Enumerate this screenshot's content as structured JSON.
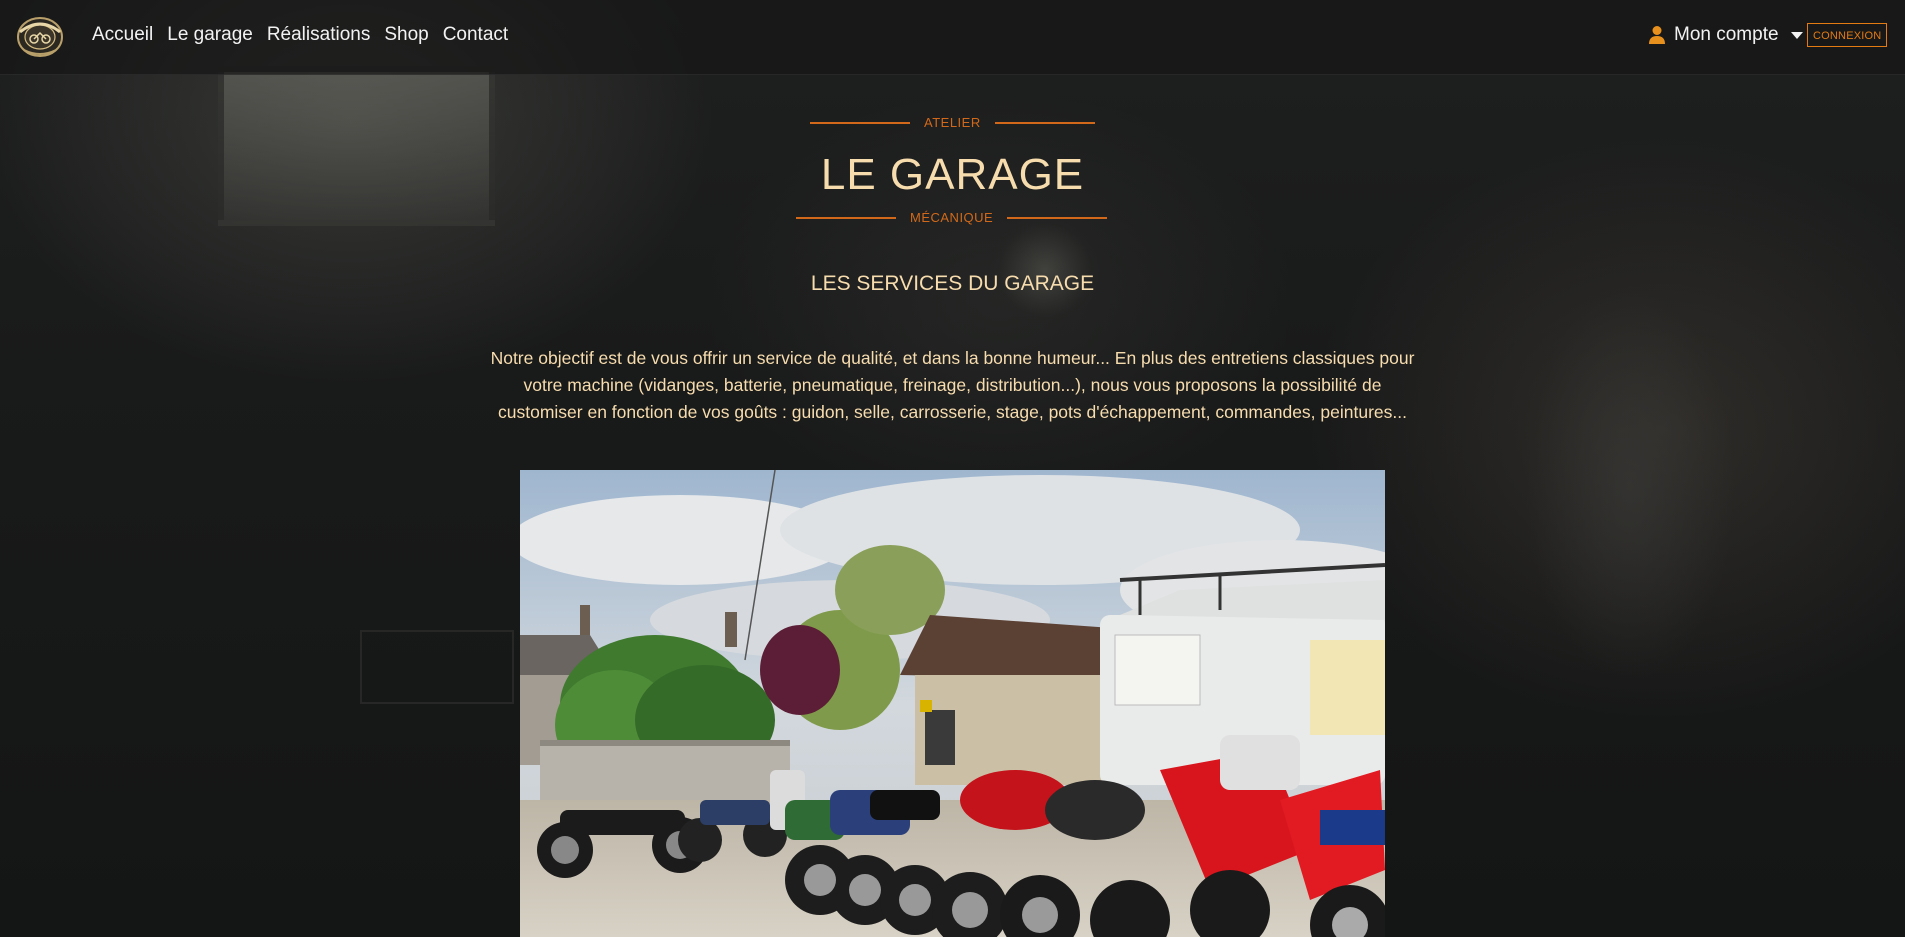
{
  "nav": {
    "links": [
      "Accueil",
      "Le garage",
      "Réalisations",
      "Shop",
      "Contact"
    ],
    "account_label": "Mon compte",
    "connexion_label": "CONNEXION"
  },
  "hero": {
    "eyebrow_top": "ATELIER",
    "title": "LE GARAGE",
    "eyebrow_bottom": "MÉCANIQUE",
    "subtitle": "LES SERVICES DU GARAGE",
    "intro": "Notre objectif est de vous offrir un service de qualité, et dans la bonne humeur... En plus des entretiens classiques pour votre machine (vidanges, batterie, pneumatique, freinage, distribution...), nous vous proposons la possibilité de customiser en fonction de vos goûts : guidon, selle, carrosserie, stage, pots d'échappement, commandes, peintures..."
  },
  "colors": {
    "accent": "#e37b12",
    "headline": "#f7dcae",
    "background": "#1a1b1b"
  },
  "icons": {
    "logo": "garage-logo-icon",
    "user": "user-icon",
    "dropdown": "caret-down-icon"
  }
}
